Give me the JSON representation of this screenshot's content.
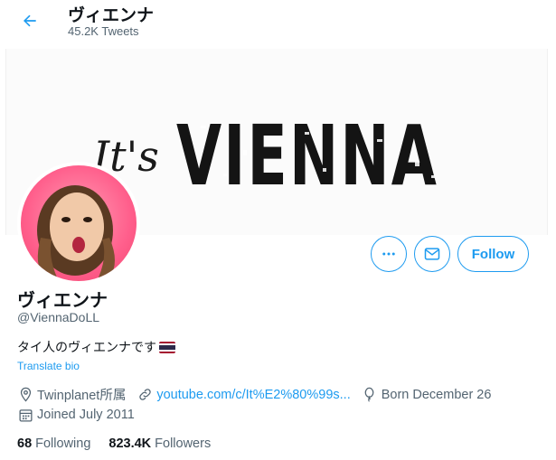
{
  "header": {
    "title": "ヴィエンナ",
    "tweet_count": "45.2K Tweets",
    "back_icon": "arrow-left-icon"
  },
  "banner": {
    "text_script": "It's",
    "text_main": "VIENNA"
  },
  "actions": {
    "more_icon": "more-dots-icon",
    "message_icon": "envelope-icon",
    "follow_label": "Follow"
  },
  "profile": {
    "name": "ヴィエンナ",
    "handle": "@ViennaDoLL",
    "bio": "タイ人のヴィエンナです",
    "translate_label": "Translate bio",
    "location": "Twinplanet所属",
    "website": "youtube.com/c/It%E2%80%99s...",
    "birthday": "Born December 26",
    "joined": "Joined July 2011"
  },
  "stats": {
    "following_count": "68",
    "following_label": "Following",
    "followers_count": "823.4K",
    "followers_label": "Followers"
  },
  "colors": {
    "accent": "#1d9bf0",
    "secondary_text": "#536471",
    "avatar_bg": "#ff5f8c"
  }
}
